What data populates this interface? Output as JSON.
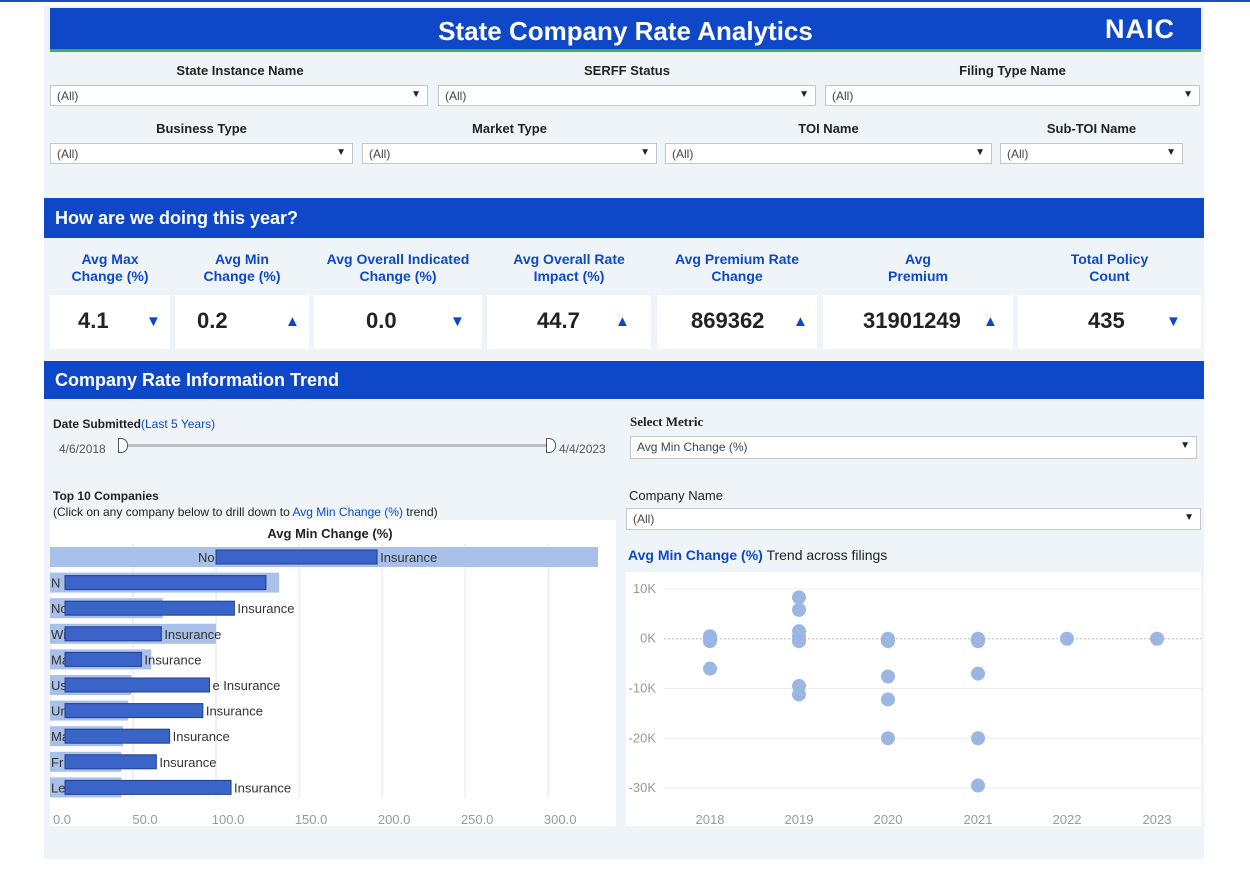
{
  "header": {
    "title": "State Company Rate Analytics",
    "logo": "NAIC"
  },
  "filters_row1": [
    {
      "label": "State Instance Name",
      "value": "(All)"
    },
    {
      "label": "SERFF Status",
      "value": "(All)"
    },
    {
      "label": "Filing Type Name",
      "value": "(All)"
    }
  ],
  "filters_row2": [
    {
      "label": "Business Type",
      "value": "(All)"
    },
    {
      "label": "Market Type",
      "value": "(All)"
    },
    {
      "label": "TOI Name",
      "value": "(All)"
    },
    {
      "label": "Sub-TOI Name",
      "value": "(All)"
    }
  ],
  "section1": {
    "title": "How are we doing this year?"
  },
  "kpis": [
    {
      "label_line1": "Avg Max",
      "label_line2": "Change (%)",
      "value": "4.1",
      "arrow": "▼"
    },
    {
      "label_line1": "Avg Min",
      "label_line2": "Change (%)",
      "value": "0.2",
      "arrow": "▲"
    },
    {
      "label_line1": "Avg Overall Indicated",
      "label_line2": "Change (%)",
      "value": "0.0",
      "arrow": "▼"
    },
    {
      "label_line1": "Avg Overall Rate",
      "label_line2": "Impact (%)",
      "value": "44.7",
      "arrow": "▲"
    },
    {
      "label_line1": "Avg Premium Rate",
      "label_line2": "Change",
      "value": "869362",
      "arrow": "▲"
    },
    {
      "label_line1": "Avg",
      "label_line2": "Premium",
      "value": "31901249",
      "arrow": "▲"
    },
    {
      "label_line1": "Total Policy",
      "label_line2": "Count",
      "value": "435",
      "arrow": "▼"
    }
  ],
  "section2": {
    "title": "Company Rate Information Trend"
  },
  "date_filter": {
    "label": "Date Submitted",
    "range_note": "(Last 5 Years)",
    "start": "4/6/2018",
    "end": "4/4/2023"
  },
  "metric_select": {
    "label": "Select Metric",
    "value": "Avg Min Change (%)"
  },
  "company_select": {
    "label": "Company Name",
    "value": "(All)"
  },
  "top10": {
    "title": "Top 10 Companies",
    "hint_prefix": "(Click on any company below to drill down to ",
    "hint_metric": "Avg Min Change (%)",
    "hint_suffix": " trend)"
  },
  "trend": {
    "metric": "Avg Min Change (%)",
    "suffix": " Trend across filings"
  },
  "colors": {
    "brand_blue": "#0e48c9",
    "bar_light": "#a9c1e8",
    "bar_dark": "#3b64c8",
    "dot": "#9bb6e2",
    "green_rule": "#3fae5c"
  },
  "chart_data": [
    {
      "type": "bar",
      "orientation": "horizontal",
      "title": "Avg Min Change (%)",
      "categories": [
        "No",
        "N",
        "No",
        "Wi",
        "Ma",
        "Us",
        "Un",
        "Ma",
        "Fr",
        "Le"
      ],
      "bar_labels": [
        "Insurance",
        "",
        "Insurance",
        "Insurance",
        "Insurance",
        "e Insurance",
        "Insurance",
        "Insurance",
        "Insurance",
        "Insurance"
      ],
      "series": [
        {
          "values": [
            330,
            138,
            68,
            100,
            61,
            49,
            47,
            44,
            43,
            43
          ]
        },
        {
          "values": [
            97,
            121,
            102,
            58,
            46,
            87,
            83,
            63,
            55,
            100
          ]
        }
      ],
      "xticks": [
        "0.0",
        "50.0",
        "100.0",
        "150.0",
        "200.0",
        "250.0",
        "300.0"
      ],
      "xlim": [
        0,
        330
      ]
    },
    {
      "type": "scatter",
      "title": "Avg Min Change (%) Trend across filings",
      "x_ticks": [
        "2018",
        "2019",
        "2020",
        "2021",
        "2022",
        "2023"
      ],
      "y_ticks": [
        "10K",
        "0K",
        "-10K",
        "-20K",
        "-30K"
      ],
      "ylim": [
        -31000,
        11000
      ],
      "points": [
        {
          "x": 2018,
          "y": 0
        },
        {
          "x": 2018,
          "y": 500
        },
        {
          "x": 2018,
          "y": -500
        },
        {
          "x": 2018,
          "y": -6000
        },
        {
          "x": 2019,
          "y": 8300
        },
        {
          "x": 2019,
          "y": 5800
        },
        {
          "x": 2019,
          "y": 1500
        },
        {
          "x": 2019,
          "y": 500
        },
        {
          "x": 2019,
          "y": -500
        },
        {
          "x": 2019,
          "y": -9500
        },
        {
          "x": 2019,
          "y": -11200
        },
        {
          "x": 2020,
          "y": 0
        },
        {
          "x": 2020,
          "y": -500
        },
        {
          "x": 2020,
          "y": -7600
        },
        {
          "x": 2020,
          "y": -12200
        },
        {
          "x": 2020,
          "y": -20000
        },
        {
          "x": 2021,
          "y": 0
        },
        {
          "x": 2021,
          "y": -500
        },
        {
          "x": 2021,
          "y": -7000
        },
        {
          "x": 2021,
          "y": -20000
        },
        {
          "x": 2021,
          "y": -29500
        },
        {
          "x": 2022,
          "y": 0
        },
        {
          "x": 2023,
          "y": 0
        }
      ]
    }
  ]
}
